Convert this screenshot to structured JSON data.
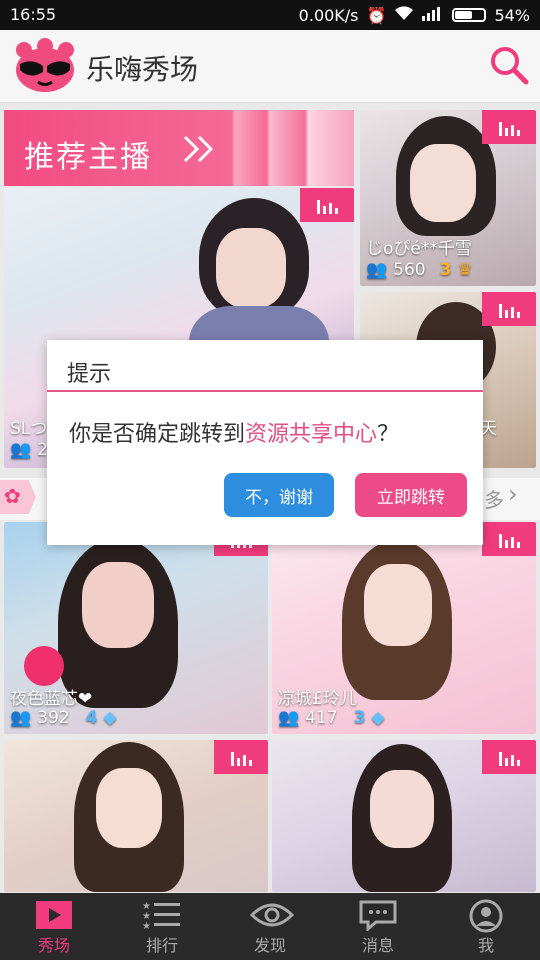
{
  "status_bar": {
    "time": "16:55",
    "net_speed": "0.00K/s",
    "battery": "54%"
  },
  "header": {
    "title": "乐嗨秀场"
  },
  "banner": {
    "label": "推荐主播"
  },
  "cards": [
    {
      "name": "",
      "viewers": "",
      "level": ""
    },
    {
      "name": "じoぴé**千雪",
      "viewers": "560",
      "level": "3"
    },
    {
      "name": "SLつ",
      "viewers": "2",
      "level": ""
    },
    {
      "name": "天",
      "viewers": "",
      "level": ""
    },
    {
      "name": "夜色蓝芯❤",
      "viewers": "392",
      "level": "4"
    },
    {
      "name": "凉城£玲儿",
      "viewers": "417",
      "level": "3"
    },
    {
      "name": "",
      "viewers": "",
      "level": ""
    },
    {
      "name": "",
      "viewers": "",
      "level": ""
    }
  ],
  "more_row": {
    "label": "多"
  },
  "dialog": {
    "title": "提示",
    "message_prefix": "你是否确定跳转到",
    "message_highlight": "资源共享中心",
    "message_suffix": "？",
    "cancel_label": "不，谢谢",
    "confirm_label": "立即跳转"
  },
  "nav": {
    "items": [
      {
        "label": "秀场",
        "icon": "play-icon"
      },
      {
        "label": "排行",
        "icon": "ranking-list-icon"
      },
      {
        "label": "发现",
        "icon": "eye-icon"
      },
      {
        "label": "消息",
        "icon": "message-icon"
      },
      {
        "label": "我",
        "icon": "profile-icon"
      }
    ]
  },
  "colors": {
    "accent": "#f03c7c",
    "confirm": "#ec4b87",
    "cancel": "#2d8ee0",
    "nav_bg": "#2a2a2a"
  }
}
